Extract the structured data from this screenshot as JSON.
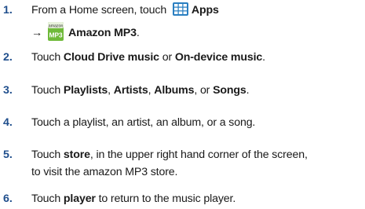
{
  "steps": [
    {
      "num": "1.",
      "line1": {
        "t1": "From a Home screen, touch ",
        "b1": "Apps"
      },
      "line2": {
        "arrow": "→",
        "b1": "Amazon MP3",
        "t2": "."
      },
      "icons": {
        "apps_icon": "apps-grid-icon",
        "mp3_icon": "amazon-mp3-icon",
        "mp3_icon_text_top": "amazon",
        "mp3_icon_text": "MP3"
      }
    },
    {
      "num": "2.",
      "line1": {
        "t1": "Touch ",
        "b1": "Cloud Drive music",
        "t2": " or ",
        "b2": "On-device music",
        "t3": "."
      }
    },
    {
      "num": "3.",
      "line1": {
        "t1": "Touch ",
        "b1": "Playlists",
        "t2": ", ",
        "b2": "Artists",
        "t3": ", ",
        "b3": "Albums",
        "t4": ", or ",
        "b4": "Songs",
        "t5": "."
      }
    },
    {
      "num": "4.",
      "line1": {
        "t1": "Touch a playlist, an artist, an album, or a song."
      }
    },
    {
      "num": "5.",
      "line1": {
        "t1": "Touch ",
        "b1": "store",
        "t2": ", in the upper right hand corner of the screen,"
      },
      "line2": {
        "t1": "to visit the amazon MP3 store."
      }
    },
    {
      "num": "6.",
      "line1": {
        "t1": "Touch ",
        "b1": "player",
        "t2": " to return to the music player."
      }
    }
  ],
  "colors": {
    "number": "#1f4e8c",
    "text": "#1a1a1a",
    "apps_icon_bg": "#2a7fc1",
    "mp3_icon_bg": "#6fba3a"
  }
}
